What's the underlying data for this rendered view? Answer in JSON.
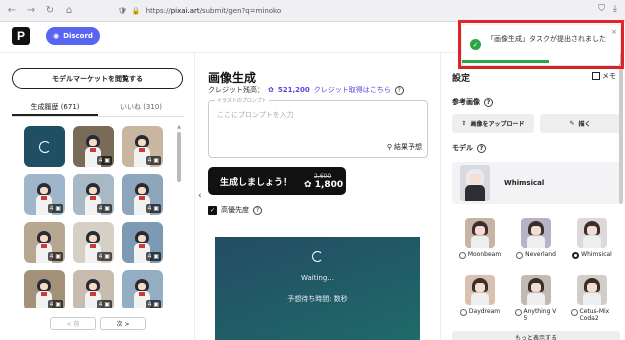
{
  "browser": {
    "url_prefix": "https://",
    "url_host": "pixai.art",
    "url_path": "/submit/gen?q=minoko"
  },
  "header": {
    "logo_letter": "P",
    "discord_label": "Discord"
  },
  "left": {
    "market_button": "モデルマーケットを閲覧する",
    "tabs": [
      {
        "label": "生成履歴 (671)",
        "active": true
      },
      {
        "label": "いいね (310)",
        "active": false
      }
    ],
    "thumbs": [
      {
        "state": "loading"
      },
      {
        "state": "image",
        "count": "4",
        "bg": "#7a6a58"
      },
      {
        "state": "image",
        "count": "4",
        "bg": "#c9b6a0"
      },
      {
        "state": "image",
        "count": "4",
        "bg": "#9fb5c9"
      },
      {
        "state": "image",
        "count": "4",
        "bg": "#a8b8c4"
      },
      {
        "state": "image",
        "count": "4",
        "bg": "#8ea6bc"
      },
      {
        "state": "image",
        "count": "4",
        "bg": "#b7a790"
      },
      {
        "state": "image",
        "count": "4",
        "bg": "#d6cfc6"
      },
      {
        "state": "image",
        "count": "4",
        "bg": "#7c9ab4"
      },
      {
        "state": "image",
        "count": "4",
        "bg": "#a39279"
      },
      {
        "state": "image",
        "count": "4",
        "bg": "#c7bcae"
      },
      {
        "state": "image",
        "count": "4",
        "bg": "#93adc2"
      }
    ],
    "pager_prev": "< 前",
    "pager_next": "次 >"
  },
  "middle": {
    "title": "画像生成",
    "credit_label": "クレジット残高：",
    "credit_value": "521,200",
    "credit_link": "クレジット取得はこちら",
    "prompt_legend": "イラストのプロンプト",
    "prompt_placeholder": "ここにプロンプトを入力",
    "prompt_predict": "結果予想",
    "generate_label": "生成しましょう！",
    "price_old": "2,600",
    "price_new": "1,800",
    "priority_label": "高優先度",
    "waiting_text": "Waiting...",
    "waiting_time": "予想待ち時間: 数秒"
  },
  "right": {
    "settings_title": "設定",
    "memo_label": "メモ",
    "ref_label": "参考画像",
    "upload_label": "画像をアップロード",
    "draw_label": "描く",
    "model_label": "モデル",
    "selected_model": "Whimsical",
    "models": [
      {
        "name": "Moonbeam",
        "selected": false,
        "bg": "#c8b4a6"
      },
      {
        "name": "Neverland",
        "selected": false,
        "bg": "#b9b2c6"
      },
      {
        "name": "Whimsical",
        "selected": true,
        "bg": "#ddd8dc"
      },
      {
        "name": "Daydream",
        "selected": false,
        "bg": "#d9c1b1"
      },
      {
        "name": "Anything V5",
        "selected": false,
        "bg": "#c3b9b1"
      },
      {
        "name": "Cetus-Mix Coda2",
        "selected": false,
        "bg": "#d2cdc8"
      }
    ],
    "show_more": "もっと表示する"
  },
  "toast": {
    "message": "「画像生成」タスクが提出されました",
    "close": "×",
    "progress": 0.55
  },
  "colors": {
    "accent": "#5b43e0",
    "discord": "#5865f2",
    "success": "#28a745",
    "highlight": "#e0262a"
  }
}
